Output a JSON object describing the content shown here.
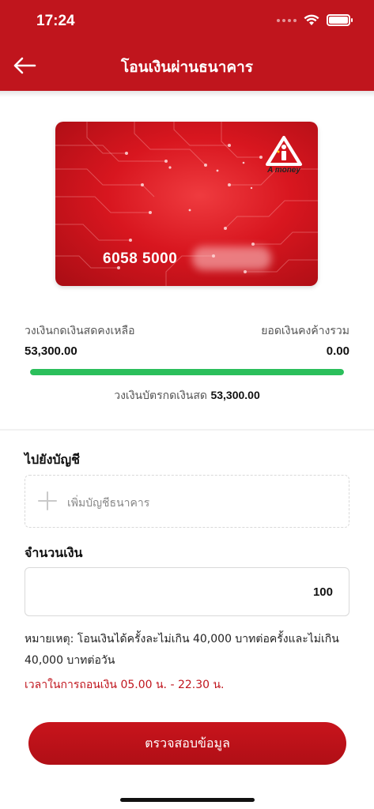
{
  "status_bar": {
    "time": "17:24"
  },
  "header": {
    "title": "โอนเงินผ่านธนาคาร",
    "back_icon": "arrow-left-icon"
  },
  "card": {
    "number_visible": "6058 5000",
    "logo_text": "A money"
  },
  "balance": {
    "available_label": "วงเงินกดเงินสดคงเหลือ",
    "available_value": "53,300.00",
    "outstanding_label": "ยอดเงินคงค้างรวม",
    "outstanding_value": "0.00",
    "progress_fraction": 1.0,
    "limit_label": "วงเงินบัตรกดเงินสด",
    "limit_value": "53,300.00"
  },
  "destination": {
    "section_label": "ไปยังบัญชี",
    "add_bank_label": "เพิ่มบัญชีธนาคาร"
  },
  "amount": {
    "section_label": "จำนวนเงิน",
    "value": "100"
  },
  "note": "หมายเหตุ: โอนเงินได้ครั้งละไม่เกิน 40,000 บาทต่อครั้งและไม่เกิน 40,000 บาทต่อวัน",
  "time_note": "เวลาในการถอนเงิน 05.00 น. - 22.30 น.",
  "submit_label": "ตรวจสอบข้อมูล",
  "colors": {
    "brand_red": "#c0151d",
    "progress_green": "#2bbf5b"
  }
}
